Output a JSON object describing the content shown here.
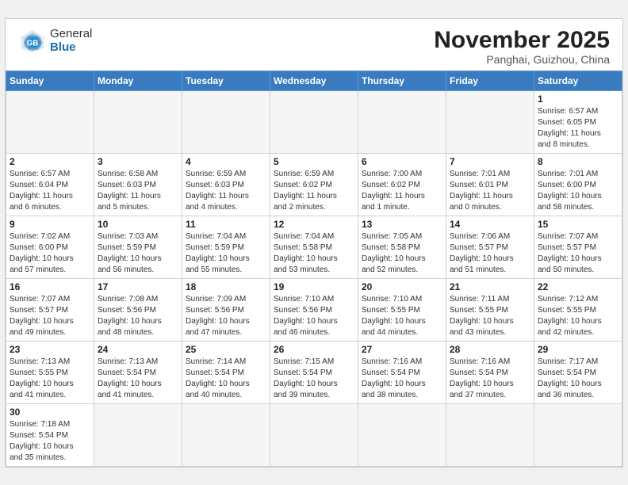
{
  "header": {
    "logo_general": "General",
    "logo_blue": "Blue",
    "month_title": "November 2025",
    "location": "Panghai, Guizhou, China"
  },
  "weekdays": [
    "Sunday",
    "Monday",
    "Tuesday",
    "Wednesday",
    "Thursday",
    "Friday",
    "Saturday"
  ],
  "days": [
    {
      "date": "",
      "info": ""
    },
    {
      "date": "",
      "info": ""
    },
    {
      "date": "",
      "info": ""
    },
    {
      "date": "",
      "info": ""
    },
    {
      "date": "",
      "info": ""
    },
    {
      "date": "",
      "info": ""
    },
    {
      "date": "1",
      "info": "Sunrise: 6:57 AM\nSunset: 6:05 PM\nDaylight: 11 hours\nand 8 minutes."
    },
    {
      "date": "2",
      "info": "Sunrise: 6:57 AM\nSunset: 6:04 PM\nDaylight: 11 hours\nand 6 minutes."
    },
    {
      "date": "3",
      "info": "Sunrise: 6:58 AM\nSunset: 6:03 PM\nDaylight: 11 hours\nand 5 minutes."
    },
    {
      "date": "4",
      "info": "Sunrise: 6:59 AM\nSunset: 6:03 PM\nDaylight: 11 hours\nand 4 minutes."
    },
    {
      "date": "5",
      "info": "Sunrise: 6:59 AM\nSunset: 6:02 PM\nDaylight: 11 hours\nand 2 minutes."
    },
    {
      "date": "6",
      "info": "Sunrise: 7:00 AM\nSunset: 6:02 PM\nDaylight: 11 hours\nand 1 minute."
    },
    {
      "date": "7",
      "info": "Sunrise: 7:01 AM\nSunset: 6:01 PM\nDaylight: 11 hours\nand 0 minutes."
    },
    {
      "date": "8",
      "info": "Sunrise: 7:01 AM\nSunset: 6:00 PM\nDaylight: 10 hours\nand 58 minutes."
    },
    {
      "date": "9",
      "info": "Sunrise: 7:02 AM\nSunset: 6:00 PM\nDaylight: 10 hours\nand 57 minutes."
    },
    {
      "date": "10",
      "info": "Sunrise: 7:03 AM\nSunset: 5:59 PM\nDaylight: 10 hours\nand 56 minutes."
    },
    {
      "date": "11",
      "info": "Sunrise: 7:04 AM\nSunset: 5:59 PM\nDaylight: 10 hours\nand 55 minutes."
    },
    {
      "date": "12",
      "info": "Sunrise: 7:04 AM\nSunset: 5:58 PM\nDaylight: 10 hours\nand 53 minutes."
    },
    {
      "date": "13",
      "info": "Sunrise: 7:05 AM\nSunset: 5:58 PM\nDaylight: 10 hours\nand 52 minutes."
    },
    {
      "date": "14",
      "info": "Sunrise: 7:06 AM\nSunset: 5:57 PM\nDaylight: 10 hours\nand 51 minutes."
    },
    {
      "date": "15",
      "info": "Sunrise: 7:07 AM\nSunset: 5:57 PM\nDaylight: 10 hours\nand 50 minutes."
    },
    {
      "date": "16",
      "info": "Sunrise: 7:07 AM\nSunset: 5:57 PM\nDaylight: 10 hours\nand 49 minutes."
    },
    {
      "date": "17",
      "info": "Sunrise: 7:08 AM\nSunset: 5:56 PM\nDaylight: 10 hours\nand 48 minutes."
    },
    {
      "date": "18",
      "info": "Sunrise: 7:09 AM\nSunset: 5:56 PM\nDaylight: 10 hours\nand 47 minutes."
    },
    {
      "date": "19",
      "info": "Sunrise: 7:10 AM\nSunset: 5:56 PM\nDaylight: 10 hours\nand 46 minutes."
    },
    {
      "date": "20",
      "info": "Sunrise: 7:10 AM\nSunset: 5:55 PM\nDaylight: 10 hours\nand 44 minutes."
    },
    {
      "date": "21",
      "info": "Sunrise: 7:11 AM\nSunset: 5:55 PM\nDaylight: 10 hours\nand 43 minutes."
    },
    {
      "date": "22",
      "info": "Sunrise: 7:12 AM\nSunset: 5:55 PM\nDaylight: 10 hours\nand 42 minutes."
    },
    {
      "date": "23",
      "info": "Sunrise: 7:13 AM\nSunset: 5:55 PM\nDaylight: 10 hours\nand 41 minutes."
    },
    {
      "date": "24",
      "info": "Sunrise: 7:13 AM\nSunset: 5:54 PM\nDaylight: 10 hours\nand 41 minutes."
    },
    {
      "date": "25",
      "info": "Sunrise: 7:14 AM\nSunset: 5:54 PM\nDaylight: 10 hours\nand 40 minutes."
    },
    {
      "date": "26",
      "info": "Sunrise: 7:15 AM\nSunset: 5:54 PM\nDaylight: 10 hours\nand 39 minutes."
    },
    {
      "date": "27",
      "info": "Sunrise: 7:16 AM\nSunset: 5:54 PM\nDaylight: 10 hours\nand 38 minutes."
    },
    {
      "date": "28",
      "info": "Sunrise: 7:16 AM\nSunset: 5:54 PM\nDaylight: 10 hours\nand 37 minutes."
    },
    {
      "date": "29",
      "info": "Sunrise: 7:17 AM\nSunset: 5:54 PM\nDaylight: 10 hours\nand 36 minutes."
    },
    {
      "date": "30",
      "info": "Sunrise: 7:18 AM\nSunset: 5:54 PM\nDaylight: 10 hours\nand 35 minutes."
    },
    {
      "date": "",
      "info": ""
    },
    {
      "date": "",
      "info": ""
    },
    {
      "date": "",
      "info": ""
    },
    {
      "date": "",
      "info": ""
    },
    {
      "date": "",
      "info": ""
    },
    {
      "date": "",
      "info": ""
    }
  ]
}
